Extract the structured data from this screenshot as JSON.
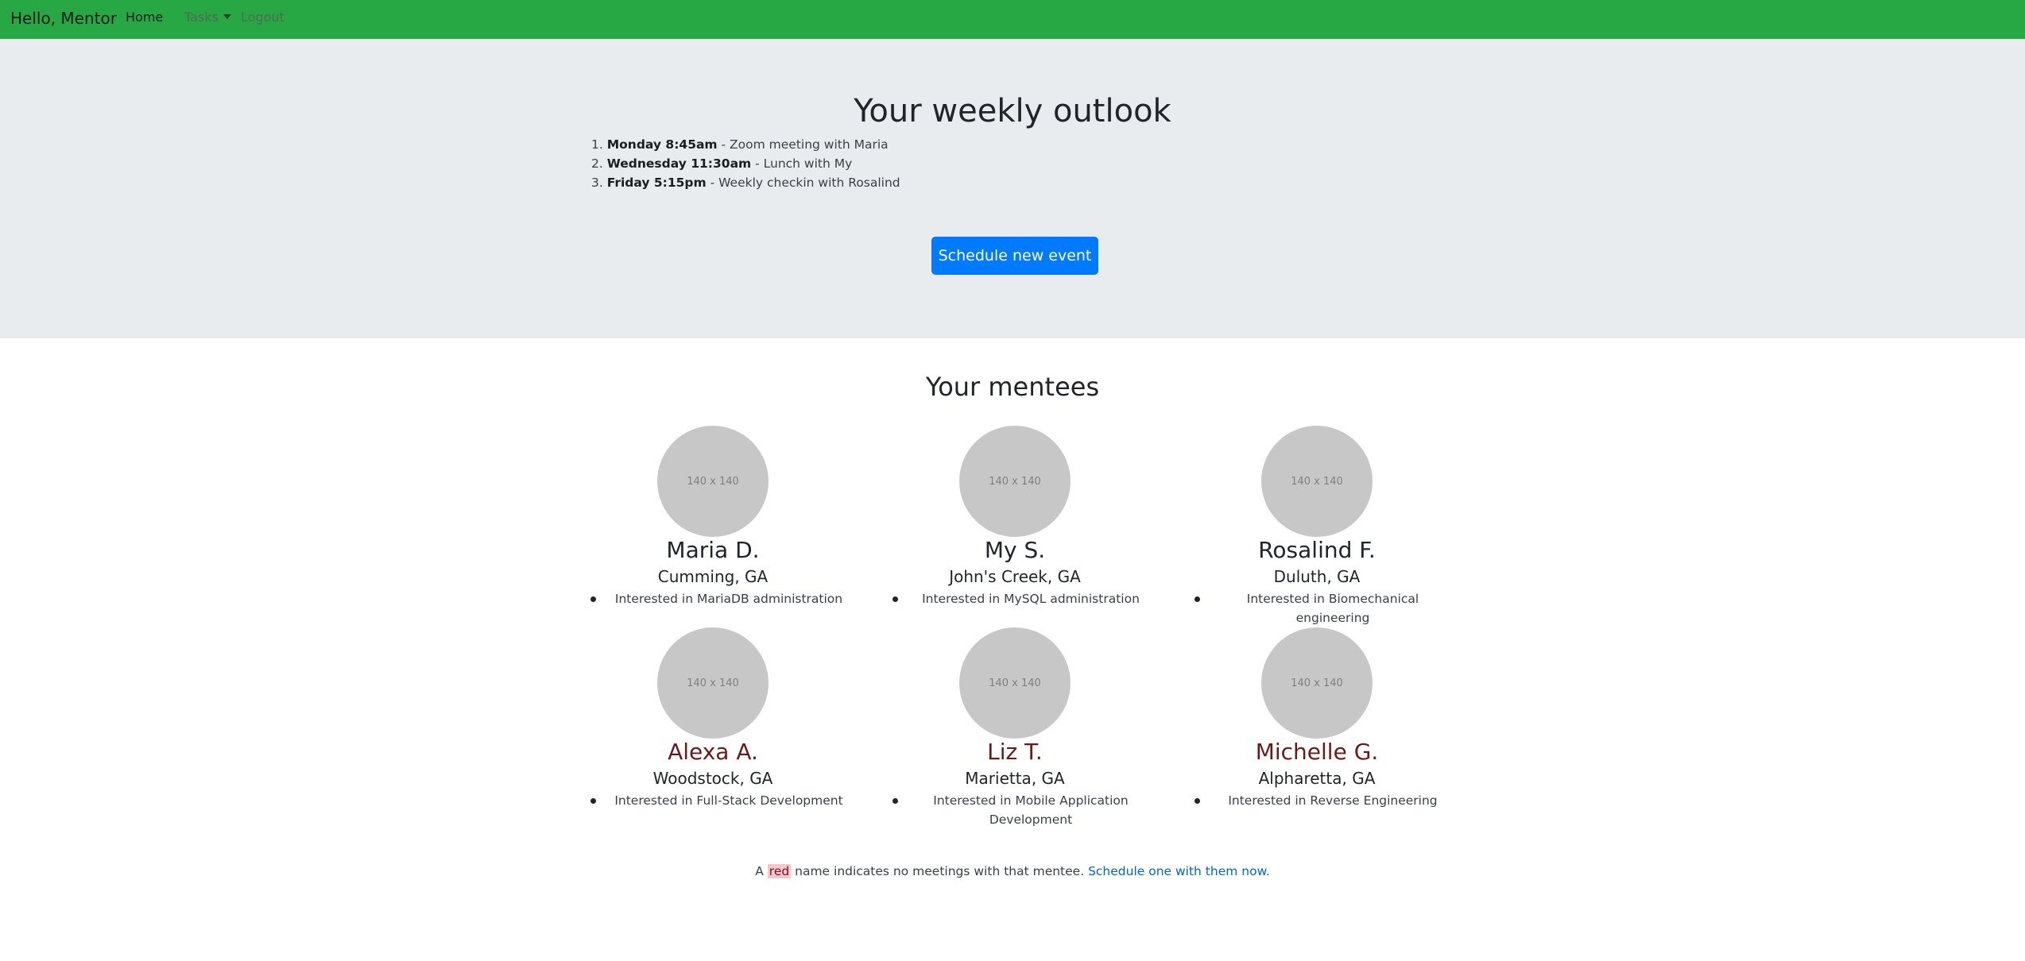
{
  "navbar": {
    "brand": "Hello, Mentor",
    "home": "Home",
    "tasks": "Tasks",
    "logout": "Logout",
    "color": "#28a745"
  },
  "outlook": {
    "title": "Your weekly outlook",
    "events": [
      {
        "number": "1.",
        "time": "Monday 8:45am",
        "desc": " - Zoom meeting with Maria"
      },
      {
        "number": "2.",
        "time": "Wednesday 11:30am",
        "desc": " - Lunch with My"
      },
      {
        "number": "3.",
        "time": "Friday 5:15pm",
        "desc": " - Weekly checkin with Rosalind"
      }
    ],
    "button": "Schedule new event",
    "button_color": "#007bff"
  },
  "mentees": {
    "title": "Your mentees",
    "placeholder": "140 x 140",
    "list": [
      {
        "name": "Maria D.",
        "location": "Cumming, GA",
        "interest": "Interested in MariaDB administration",
        "no_meetings": false
      },
      {
        "name": "My S.",
        "location": "John's Creek, GA",
        "interest": "Interested in MySQL administration",
        "no_meetings": false
      },
      {
        "name": "Rosalind F.",
        "location": "Duluth, GA",
        "interest": "Interested in Biomechanical engineering",
        "no_meetings": false
      },
      {
        "name": "Alexa A.",
        "location": "Woodstock, GA",
        "interest": "Interested in Full-Stack Development",
        "no_meetings": true
      },
      {
        "name": "Liz T.",
        "location": "Marietta, GA",
        "interest": "Interested in Mobile Application Development",
        "no_meetings": true
      },
      {
        "name": "Michelle G.",
        "location": "Alpharetta, GA",
        "interest": "Interested in Reverse Engineering",
        "no_meetings": true
      }
    ]
  },
  "footnote": {
    "prefix": "A ",
    "red_word": "red",
    "middle": " name indicates no meetings with that mentee. ",
    "link": "Schedule one with them now."
  }
}
